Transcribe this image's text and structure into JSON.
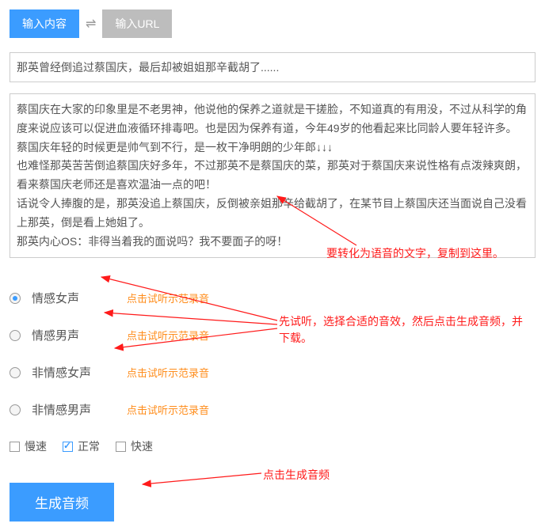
{
  "tabs": {
    "content": "输入内容",
    "url": "输入URL",
    "swap": "⇌"
  },
  "titleLine": "那英曾经倒追过蔡国庆，最后却被姐姐那辛截胡了......",
  "body": {
    "p1": "蔡国庆在大家的印象里是不老男神，他说他的保养之道就是干搓脸，不知道真的有用没，不过从科学的角度来说应该可以促进血液循环排毒吧。也是因为保养有道，今年49岁的他看起来比同龄人要年轻许多。",
    "p2": "蔡国庆年轻的时候更是帅气到不行，是一枚干净明朗的少年郎↓↓↓",
    "p3": "也难怪那英苦苦倒追蔡国庆好多年，不过那英不是蔡国庆的菜，那英对于蔡国庆来说性格有点泼辣爽朗，看来蔡国庆老师还是喜欢温油一点的吧！",
    "p4": "话说令人捧腹的是，那英没追上蔡国庆，反倒被亲姐那辛给截胡了，在某节目上蔡国庆还当面说自己没看上那英，倒是看上她姐了。",
    "p5": "那英内心OS：非得当着我的面说吗？我不要面子的呀！"
  },
  "voices": {
    "v1": "情感女声",
    "v2": "情感男声",
    "v3": "非情感女声",
    "v4": "非情感男声",
    "listen": "点击试听示范录音"
  },
  "speed": {
    "slow": "慢速",
    "normal": "正常",
    "fast": "快速"
  },
  "generate": "生成音频",
  "annotations": {
    "a1": "要转化为语音的文字，复制到这里。",
    "a2": "先试听，选择合适的音效，然后点击生成音频，并下载。",
    "a3": "点击生成音频"
  }
}
